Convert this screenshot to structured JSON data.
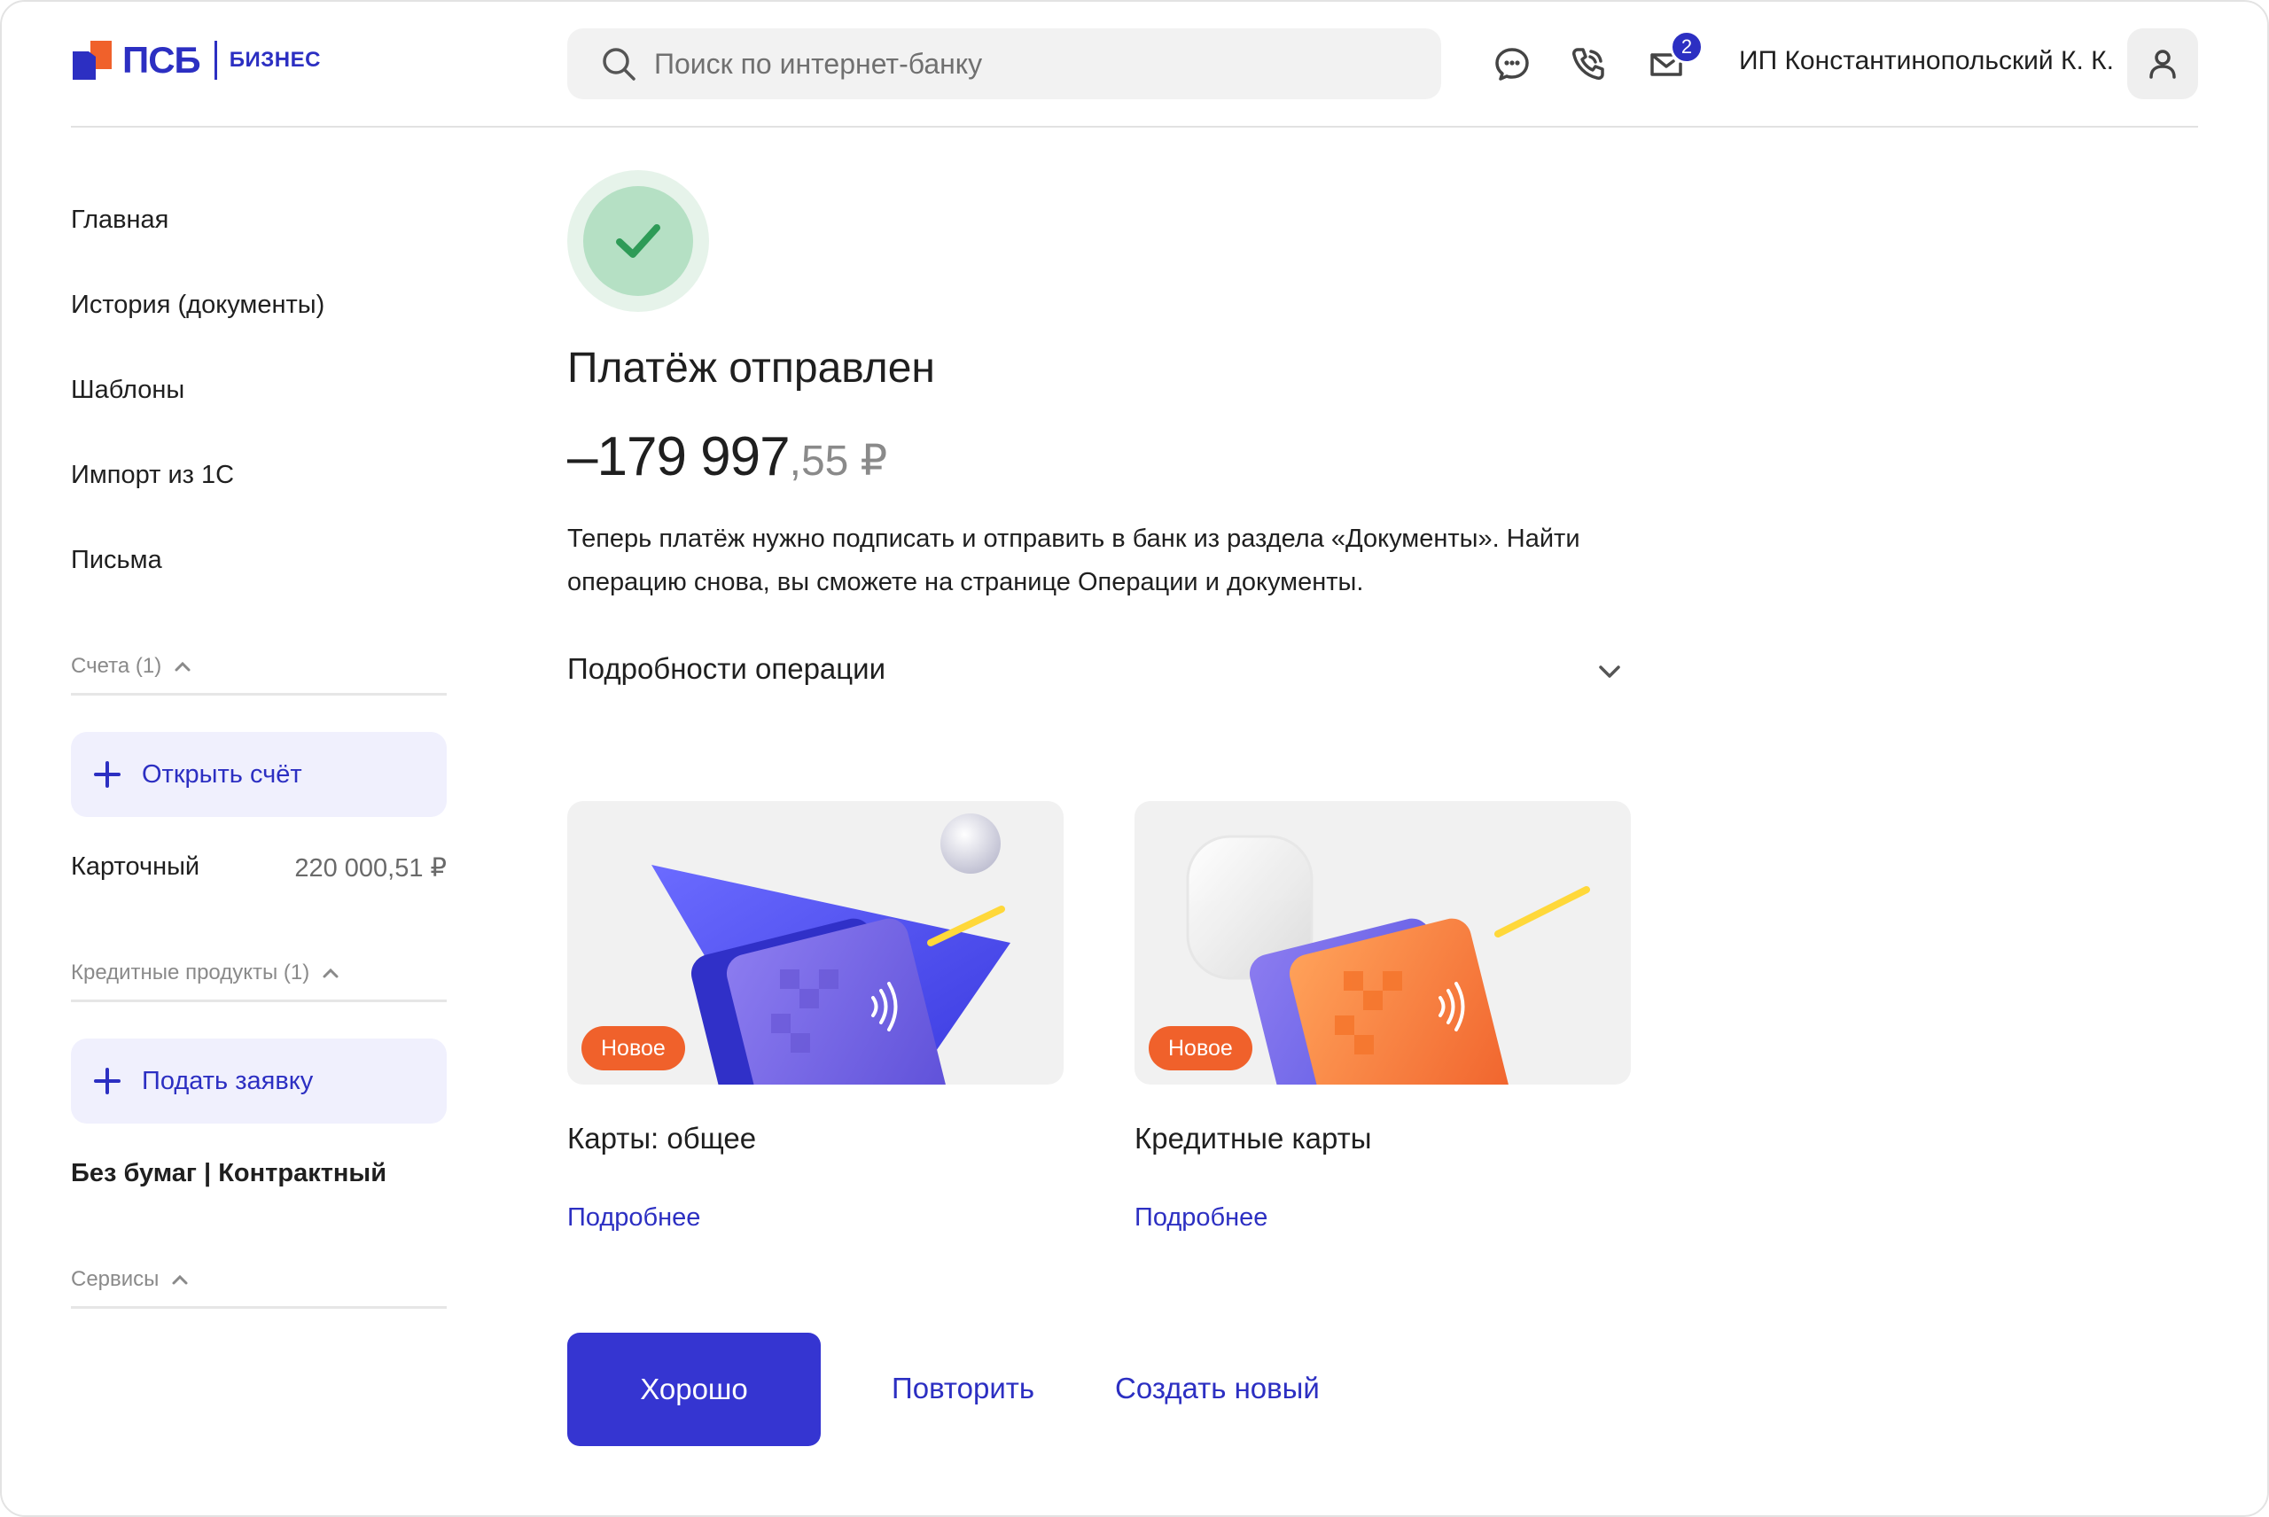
{
  "brand": {
    "name": "ПСБ",
    "sub": "БИЗНЕС",
    "colors": {
      "primary": "#2C2FC2",
      "accent": "#F0612B",
      "success": "#2E9B57"
    }
  },
  "header": {
    "search_placeholder": "Поиск по интернет-банку",
    "icons": [
      "chat-icon",
      "phone-icon",
      "mail-icon"
    ],
    "notifications_count": "2",
    "user_name": "ИП Константинопольский К. К."
  },
  "sidebar": {
    "nav": [
      {
        "label": "Главная"
      },
      {
        "label": "История (документы)"
      },
      {
        "label": "Шаблоны"
      },
      {
        "label": "Импорт из 1С"
      },
      {
        "label": "Письма"
      }
    ],
    "accounts": {
      "header": "Счета (1)",
      "open_button": "Открыть счёт",
      "items": [
        {
          "name": "Карточный",
          "balance": "220 000,51 ₽"
        }
      ]
    },
    "credit": {
      "header": "Кредитные продукты (1)",
      "apply_button": "Подать заявку",
      "item": "Без бумаг | Контрактный"
    },
    "services": {
      "header": "Сервисы"
    }
  },
  "main": {
    "title": "Платёж отправлен",
    "amount_main": "–179 997",
    "amount_fraction": ",55 ₽",
    "description": "Теперь платёж нужно подписать и отправить в банк из раздела «Документы». Найти операцию снова, вы сможете на странице Операции и документы.",
    "details_label": "Подробности операции",
    "cards": [
      {
        "tag": "Новое",
        "title": "Карты: общее",
        "link": "Подробнее"
      },
      {
        "tag": "Новое",
        "title": "Кредитные карты",
        "link": "Подробнее"
      }
    ],
    "actions": {
      "ok": "Хорошо",
      "repeat": "Повторить",
      "create": "Создать новый"
    }
  }
}
